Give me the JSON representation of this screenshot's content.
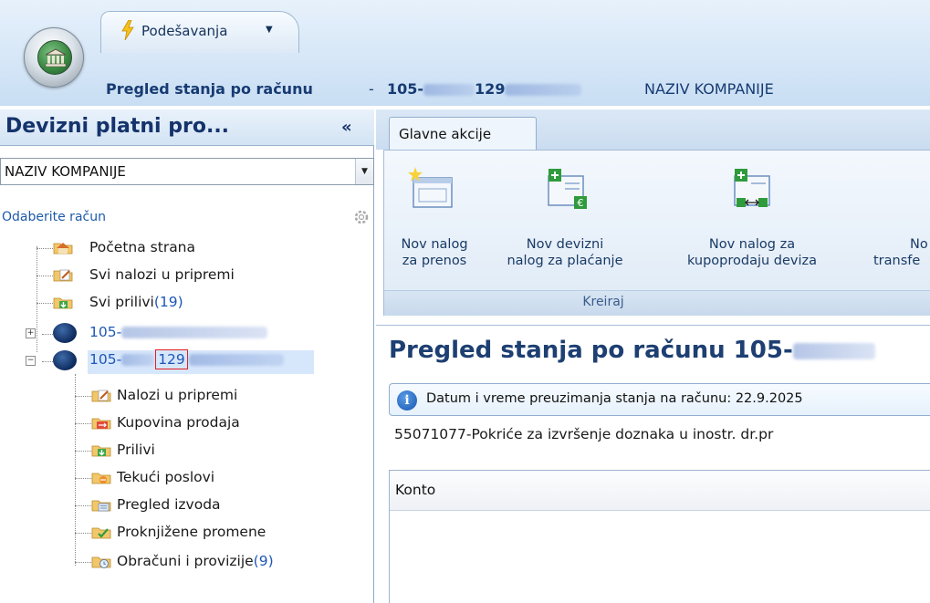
{
  "app": {
    "settings_menu": "Podešavanja",
    "title_prefix": "Pregled stanja po računu",
    "title_separator": "-",
    "title_account_start": "105-",
    "title_account_mid": "129",
    "title_company": "NAZIV KOMPANIJE"
  },
  "left": {
    "title": "Devizni platni pro...",
    "collapse_glyph": "«",
    "company": "NAZIV KOMPANIJE",
    "choose_account_label": "Odaberite račun",
    "tree": {
      "home": "Početna strana",
      "all_drafts": "Svi nalozi u pripremi",
      "all_inflows": "Svi prilivi",
      "all_inflows_count": "(19)",
      "account1_prefix": "105-",
      "account2_prefix": "105-",
      "account2_highlight": "129",
      "children": {
        "drafts": "Nalozi u pripremi",
        "buy_sell": "Kupovina prodaja",
        "inflows": "Prilivi",
        "current": "Tekući poslovi",
        "statements": "Pregled izvoda",
        "posted": "Proknjižene promene",
        "fees": "Obračuni i provizije",
        "fees_count": "(9)"
      }
    }
  },
  "ribbon": {
    "tab": "Glavne akcije",
    "buttons": [
      {
        "line1": "Nov nalog",
        "line2": "za prenos"
      },
      {
        "line1": "Nov devizni",
        "line2": "nalog za plaćanje"
      },
      {
        "line1": "Nov nalog za",
        "line2": "kupoprodaju deviza"
      },
      {
        "line1": "No",
        "line2": "transfe"
      }
    ],
    "group_label": "Kreiraj"
  },
  "content": {
    "title": "Pregled stanja po računu 105-",
    "info": "Datum i vreme preuzimanja stanja na računu: 22.9.2025",
    "detail": "55071077-Pokriće za izvršenje doznaka u inostr. dr.pr",
    "grid_column": "Konto"
  }
}
